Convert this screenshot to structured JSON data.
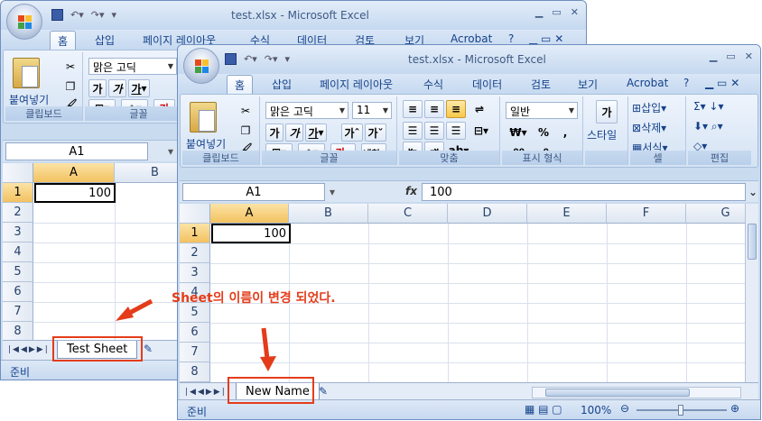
{
  "back_window": {
    "title": "test.xlsx - Microsoft Excel",
    "tabs": [
      "홈",
      "삽입",
      "페이지 레이아웃",
      "수식",
      "데이터",
      "검토",
      "보기",
      "Acrobat"
    ],
    "paste_label": "붙여넣기",
    "font_name": "맑은 고딕",
    "group_clipboard": "클립보드",
    "group_font": "글꼴",
    "name_box": "A1",
    "columns": [
      "A",
      "B"
    ],
    "rows": [
      "1",
      "2",
      "3",
      "4",
      "5",
      "6",
      "7",
      "8"
    ],
    "cell_a1": "100",
    "sheet_tab": "Test Sheet",
    "status": "준비"
  },
  "front_window": {
    "title": "test.xlsx - Microsoft Excel",
    "tabs": [
      "홈",
      "삽입",
      "페이지 레이아웃",
      "수식",
      "데이터",
      "검토",
      "보기",
      "Acrobat"
    ],
    "paste_label": "붙여넣기",
    "font_name": "맑은 고딕",
    "font_size": "11",
    "number_format": "일반",
    "style_label": "스타일",
    "cell_insert": "삽입",
    "cell_delete": "삭제",
    "cell_format": "서식",
    "group_clipboard": "클립보드",
    "group_font": "글꼴",
    "group_align": "맞춤",
    "group_number": "표시 형식",
    "group_cells": "셀",
    "group_edit": "편집",
    "name_box": "A1",
    "fx": "fx",
    "formula_value": "100",
    "columns": [
      "A",
      "B",
      "C",
      "D",
      "E",
      "F",
      "G"
    ],
    "rows": [
      "1",
      "2",
      "3",
      "4",
      "5",
      "6",
      "7",
      "8"
    ],
    "cell_a1": "100",
    "sheet_tab": "New Name",
    "status": "준비",
    "zoom": "100%"
  },
  "annotation": "Sheet의 이름이 변경 되었다.",
  "colors": {
    "accent_red": "#e43c1a",
    "ribbon_blue": "#c9dbef"
  }
}
